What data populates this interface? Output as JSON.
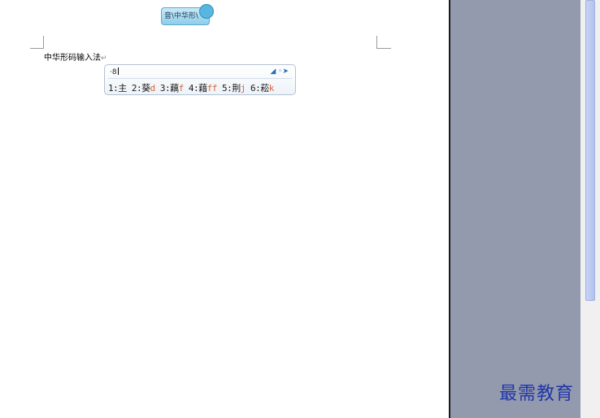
{
  "ime_badge": {
    "label": "音\\中华形\\"
  },
  "document": {
    "text": "中华形码输入法",
    "return_mark": "↵"
  },
  "candidate_window": {
    "input": "·8",
    "icons": "◢ ◦➤",
    "candidates": [
      {
        "index": "1:",
        "char": "主",
        "code": ""
      },
      {
        "index": "2:",
        "char": "葵",
        "code": "d"
      },
      {
        "index": "3:",
        "char": "藕",
        "code": "f"
      },
      {
        "index": "4:",
        "char": "藉",
        "code": "ff"
      },
      {
        "index": "5:",
        "char": "荆",
        "code": "j"
      },
      {
        "index": "6:",
        "char": "菘",
        "code": "k"
      }
    ]
  },
  "watermark": {
    "text": "最需教育"
  },
  "colors": {
    "side_panel": "#939aae",
    "scroll_thumb": "#b2c3ee",
    "watermark": "#2036a8",
    "code": "#d06a3a"
  }
}
